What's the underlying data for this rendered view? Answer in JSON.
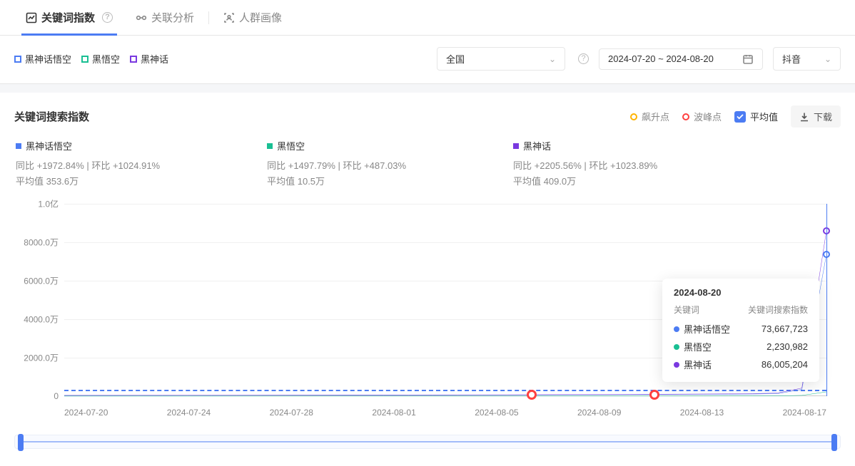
{
  "tabs": {
    "keyword_index": "关键词指数",
    "correlation": "关联分析",
    "audience": "人群画像"
  },
  "legend_keywords": [
    "黑神话悟空",
    "黑悟空",
    "黑神话"
  ],
  "filters": {
    "region": "全国",
    "date_range": "2024-07-20 ~ 2024-08-20",
    "platform": "抖音"
  },
  "section_title": "关键词搜索指数",
  "markers": {
    "surge": "飙升点",
    "peak": "波峰点",
    "avg": "平均值",
    "download": "下载"
  },
  "stats": [
    {
      "color": "#4c7cf3",
      "name": "黑神话悟空",
      "yoy": "+1972.84%",
      "mom": "+1024.91%",
      "avg": "353.6万"
    },
    {
      "color": "#1abf93",
      "name": "黑悟空",
      "yoy": "+1497.79%",
      "mom": "+487.03%",
      "avg": "10.5万"
    },
    {
      "color": "#7a39e0",
      "name": "黑神话",
      "yoy": "+2205.56%",
      "mom": "+1023.89%",
      "avg": "409.0万"
    }
  ],
  "stat_labels": {
    "yoy": "同比",
    "mom": "环比",
    "avg": "平均值"
  },
  "tooltip": {
    "date": "2024-08-20",
    "col_keyword": "关键词",
    "col_value": "关键词搜索指数",
    "rows": [
      {
        "color": "#4c7cf3",
        "name": "黑神话悟空",
        "value": "73,667,723"
      },
      {
        "color": "#1abf93",
        "name": "黑悟空",
        "value": "2,230,982"
      },
      {
        "color": "#7a39e0",
        "name": "黑神话",
        "value": "86,005,204"
      }
    ]
  },
  "chart_data": {
    "type": "line",
    "xlabel": "",
    "ylabel": "",
    "ylim": [
      0,
      100000000
    ],
    "y_ticks": [
      "0",
      "2000.0万",
      "4000.0万",
      "6000.0万",
      "8000.0万",
      "1.0亿"
    ],
    "x_ticks": [
      "2024-07-20",
      "2024-07-24",
      "2024-07-28",
      "2024-08-01",
      "2024-08-05",
      "2024-08-09",
      "2024-08-13",
      "2024-08-17"
    ],
    "x": [
      "2024-07-20",
      "2024-07-21",
      "2024-07-22",
      "2024-07-23",
      "2024-07-24",
      "2024-07-25",
      "2024-07-26",
      "2024-07-27",
      "2024-07-28",
      "2024-07-29",
      "2024-07-30",
      "2024-07-31",
      "2024-08-01",
      "2024-08-02",
      "2024-08-03",
      "2024-08-04",
      "2024-08-05",
      "2024-08-06",
      "2024-08-07",
      "2024-08-08",
      "2024-08-09",
      "2024-08-10",
      "2024-08-11",
      "2024-08-12",
      "2024-08-13",
      "2024-08-14",
      "2024-08-15",
      "2024-08-16",
      "2024-08-17",
      "2024-08-18",
      "2024-08-19",
      "2024-08-20"
    ],
    "average_lines": {
      "黑神话悟空": 3536000,
      "黑悟空": 105000,
      "黑神话": 4090000
    },
    "markers": {
      "peak": [
        "2024-08-08",
        "2024-08-13"
      ]
    },
    "series": [
      {
        "name": "黑神话悟空",
        "color": "#4c7cf3",
        "values": [
          350000,
          380000,
          370000,
          400000,
          380000,
          420000,
          400000,
          430000,
          450000,
          460000,
          480000,
          470000,
          500000,
          520000,
          540000,
          530000,
          560000,
          580000,
          600000,
          650000,
          700000,
          720000,
          750000,
          800000,
          850000,
          900000,
          950000,
          1000000,
          1100000,
          1300000,
          3500000,
          73667723
        ]
      },
      {
        "name": "黑悟空",
        "color": "#1abf93",
        "values": [
          30000,
          32000,
          35000,
          36000,
          34000,
          37000,
          39000,
          40000,
          41000,
          42000,
          43000,
          44000,
          45000,
          46000,
          47000,
          48000,
          50000,
          52000,
          54000,
          56000,
          58000,
          60000,
          63000,
          66000,
          70000,
          75000,
          80000,
          90000,
          100000,
          130000,
          400000,
          2230982
        ]
      },
      {
        "name": "黑神话",
        "color": "#7a39e0",
        "values": [
          400000,
          420000,
          430000,
          450000,
          460000,
          470000,
          480000,
          500000,
          520000,
          540000,
          550000,
          570000,
          600000,
          620000,
          640000,
          660000,
          680000,
          700000,
          720000,
          770000,
          820000,
          850000,
          880000,
          930000,
          990000,
          1050000,
          1120000,
          1200000,
          1350000,
          1600000,
          4200000,
          86005204
        ]
      }
    ]
  }
}
